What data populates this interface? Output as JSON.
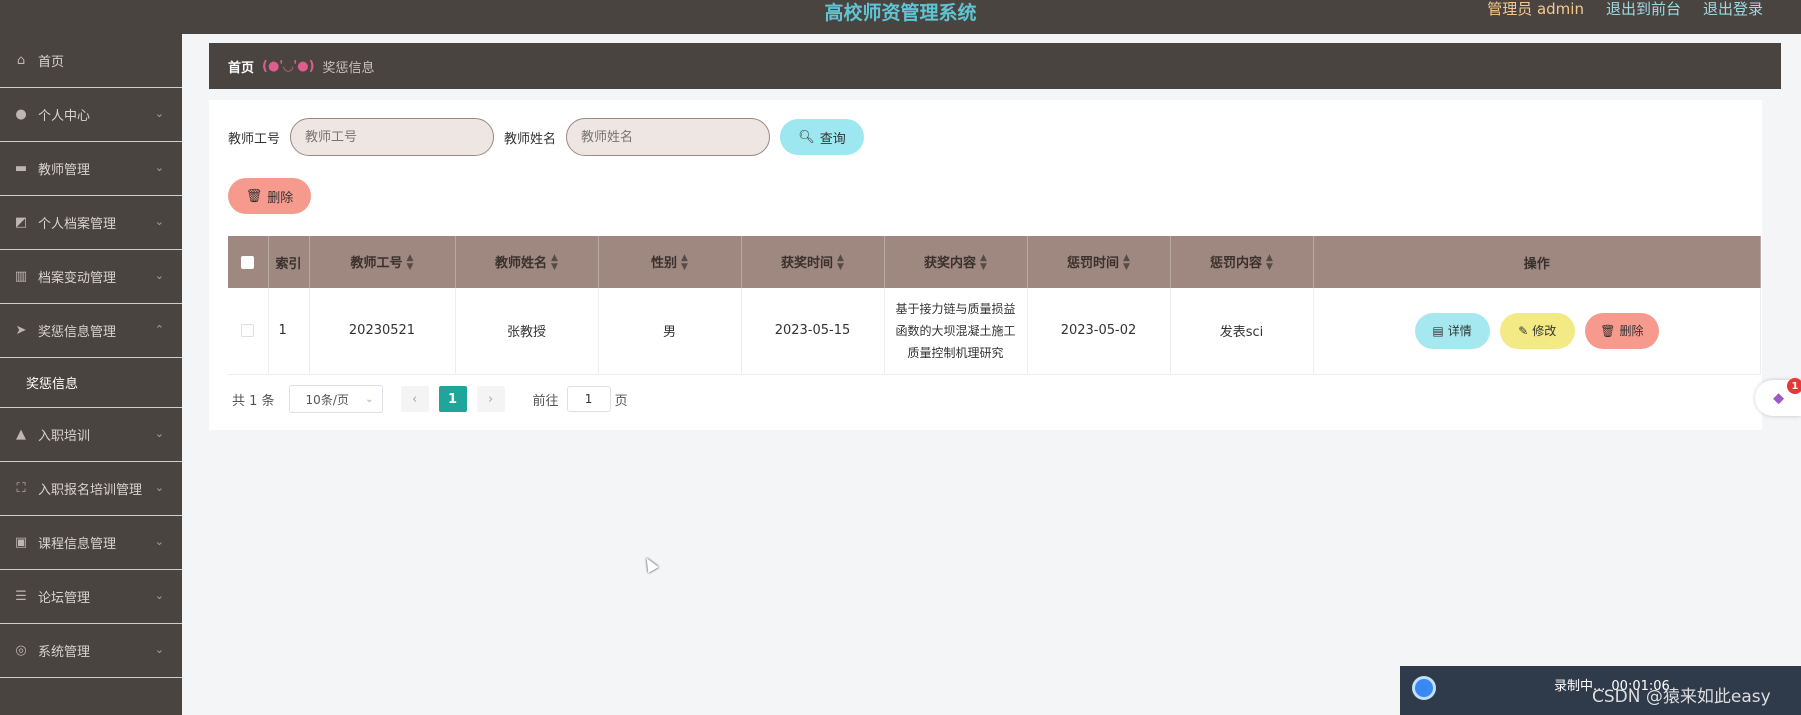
{
  "header": {
    "title": "高校师资管理系统",
    "user": "管理员 admin",
    "front_link": "退出到前台",
    "logout_link": "退出登录"
  },
  "sidebar": {
    "items": [
      {
        "label": "首页",
        "icon": "home-icon"
      },
      {
        "label": "个人中心",
        "icon": "user-icon"
      },
      {
        "label": "教师管理",
        "icon": "briefcase-icon"
      },
      {
        "label": "个人档案管理",
        "icon": "chart-icon"
      },
      {
        "label": "档案变动管理",
        "icon": "bar-chart-icon"
      },
      {
        "label": "奖惩信息管理",
        "icon": "send-icon"
      },
      {
        "label": "入职培训",
        "icon": "thumb-icon"
      },
      {
        "label": "入职报名培训管理",
        "icon": "fullscreen-icon"
      },
      {
        "label": "课程信息管理",
        "icon": "clipboard-icon"
      },
      {
        "label": "论坛管理",
        "icon": "list-icon"
      },
      {
        "label": "系统管理",
        "icon": "settings-circle-icon"
      }
    ],
    "sub_item": "奖惩信息"
  },
  "breadcrumb": {
    "home": "首页",
    "separator": "(●'◡'●)",
    "current": "奖惩信息"
  },
  "search": {
    "teacher_no_label": "教师工号",
    "teacher_no_placeholder": "教师工号",
    "teacher_name_label": "教师姓名",
    "teacher_name_placeholder": "教师姓名",
    "query_button": "查询"
  },
  "toolbar": {
    "delete_button": "删除"
  },
  "table": {
    "headers": [
      "索引",
      "教师工号",
      "教师姓名",
      "性别",
      "获奖时间",
      "获奖内容",
      "惩罚时间",
      "惩罚内容",
      "操作"
    ],
    "rows": [
      {
        "index": "1",
        "teacher_no": "20230521",
        "teacher_name": "张教授",
        "gender": "男",
        "award_time": "2023-05-15",
        "award_line1": "基于接力链与质量损益",
        "award_line2": "函数的大坝混凝土施工",
        "award_line3": "质量控制机理研究",
        "penalty_time": "2023-05-02",
        "penalty_content": "发表sci",
        "detail_button": "详情",
        "edit_button": "修改",
        "delete_button": "删除"
      }
    ]
  },
  "pagination": {
    "total": "共 1 条",
    "page_size": "10条/页",
    "current_page": "1",
    "goto_label": "前往",
    "goto_value": "1",
    "page_suffix": "页"
  },
  "overlay": {
    "badge": "1",
    "recording": "录制中...",
    "recording_time": "00:01:06",
    "watermark": "CSDN @猿来如此easy"
  },
  "colors": {
    "sidebar_bg": "#4a4441",
    "title": "#5fc4d3",
    "table_header": "#9e8880",
    "query_btn": "#9ce7f0",
    "delete_btn": "#f59a8c",
    "edit_btn": "#f3ea85",
    "page_active": "#1fa59a"
  }
}
